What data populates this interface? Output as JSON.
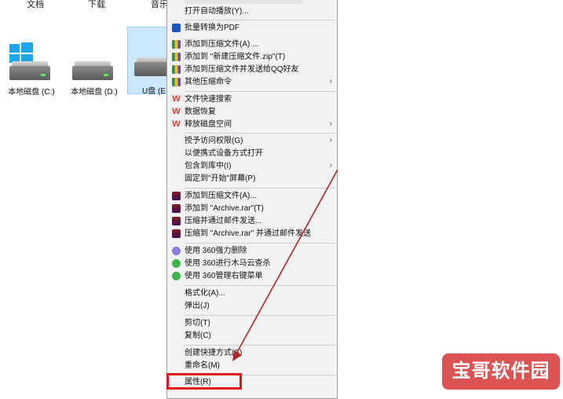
{
  "topbar": {
    "col1": "文档",
    "col2": "下载",
    "col3": "音乐"
  },
  "drives": [
    {
      "label": "本地磁盘 (C:)"
    },
    {
      "label": "本地磁盘 (D:)"
    },
    {
      "label": "U盘 (E"
    }
  ],
  "menu": {
    "items_top": [
      {
        "label": "打开自动播放(Y)..."
      },
      {
        "label": "批量转换为PDF",
        "icon": "pdf-icon"
      },
      {
        "label": "添加到压缩文件(A) ...",
        "icon": "zip-icon"
      },
      {
        "label": "添加到 \"新建压缩文件.zip\"(T)",
        "icon": "zip-icon"
      },
      {
        "label": "添加到压缩文件并发送给QQ好友",
        "icon": "zip-icon"
      },
      {
        "label": "其他压缩命令",
        "icon": "zip-icon"
      },
      {
        "label": "文件快速搜索",
        "icon": "wps-icon"
      },
      {
        "label": "数据恢复",
        "icon": "wps-icon"
      },
      {
        "label": "释放磁盘空间",
        "icon": "wps-icon"
      },
      {
        "label": "授予访问权限(G)"
      },
      {
        "label": "以便携式设备方式打开"
      },
      {
        "label": "包含到库中(I)"
      },
      {
        "label": "固定到\"开始\"屏幕(P)"
      },
      {
        "label": "添加到压缩文件(A)...",
        "icon": "rar-icon"
      },
      {
        "label": "添加到 \"Archive.rar\"(T)",
        "icon": "rar-icon"
      },
      {
        "label": "压缩并通过邮件发送...",
        "icon": "rar-icon"
      },
      {
        "label": "压缩到 \"Archive.rar\" 并通过邮件发送",
        "icon": "rar-icon"
      },
      {
        "label": "使用 360强力删除",
        "icon": "shred-icon"
      },
      {
        "label": "使用 360进行木马云查杀",
        "icon": "360-icon"
      },
      {
        "label": "使用 360管理右键菜单",
        "icon": "360-icon"
      },
      {
        "label": "格式化(A)..."
      },
      {
        "label": "弹出(J)"
      },
      {
        "label": "剪切(T)"
      },
      {
        "label": "复制(C)"
      },
      {
        "label": "创建快捷方式(S)"
      },
      {
        "label": "重命名(M)"
      },
      {
        "label": "属性(R)"
      }
    ],
    "submenu_arrow": "›"
  },
  "watermark": "宝哥软件园",
  "colors": {
    "highlight": "#e0141e",
    "arrow": "#b0262b",
    "selection": "#cce8ff"
  }
}
